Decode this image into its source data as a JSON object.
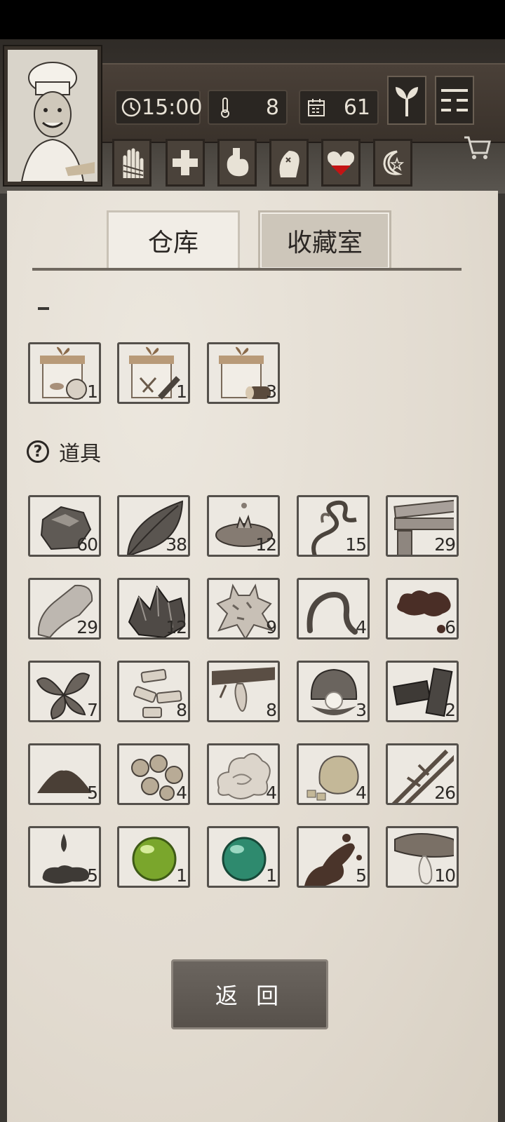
{
  "hud": {
    "time": "15:00",
    "temperature": "8",
    "day": "61"
  },
  "tabs": {
    "warehouse": "仓库",
    "collection": "收藏室"
  },
  "section": {
    "help_symbol": "?",
    "title": "道具"
  },
  "top_items": [
    {
      "icon": "gift-box-food-icon",
      "count": "1"
    },
    {
      "icon": "gift-box-tools-icon",
      "count": "1"
    },
    {
      "icon": "gift-box-logs-icon",
      "count": "3"
    }
  ],
  "items": [
    {
      "icon": "stone-icon",
      "count": "60"
    },
    {
      "icon": "leaf-icon",
      "count": "38"
    },
    {
      "icon": "resin-puddle-icon",
      "count": "12"
    },
    {
      "icon": "vine-icon",
      "count": "15"
    },
    {
      "icon": "wood-planks-icon",
      "count": "29"
    },
    {
      "icon": "flint-icon",
      "count": "29"
    },
    {
      "icon": "ore-crystal-icon",
      "count": "12"
    },
    {
      "icon": "animal-hide-icon",
      "count": "9"
    },
    {
      "icon": "worm-icon",
      "count": "4"
    },
    {
      "icon": "tar-drops-icon",
      "count": "6"
    },
    {
      "icon": "herb-leaves-icon",
      "count": "7"
    },
    {
      "icon": "bark-pieces-icon",
      "count": "8"
    },
    {
      "icon": "sap-branch-icon",
      "count": "8"
    },
    {
      "icon": "pearl-shell-icon",
      "count": "3"
    },
    {
      "icon": "charcoal-icon",
      "count": "2"
    },
    {
      "icon": "soil-pile-icon",
      "count": "5"
    },
    {
      "icon": "gold-nuggets-icon",
      "count": "4"
    },
    {
      "icon": "cotton-fiber-icon",
      "count": "4"
    },
    {
      "icon": "sandstone-icon",
      "count": "4"
    },
    {
      "icon": "bamboo-icon",
      "count": "26"
    },
    {
      "icon": "oil-drop-icon",
      "count": "5"
    },
    {
      "icon": "green-orb-icon",
      "count": "1"
    },
    {
      "icon": "teal-orb-icon",
      "count": "1"
    },
    {
      "icon": "mud-splat-icon",
      "count": "5"
    },
    {
      "icon": "fish-oil-icon",
      "count": "10"
    }
  ],
  "back_button": "返 回",
  "colors": {
    "paper": "#e6e0d6",
    "slot_border": "#54504b",
    "button": "#5f5953"
  }
}
